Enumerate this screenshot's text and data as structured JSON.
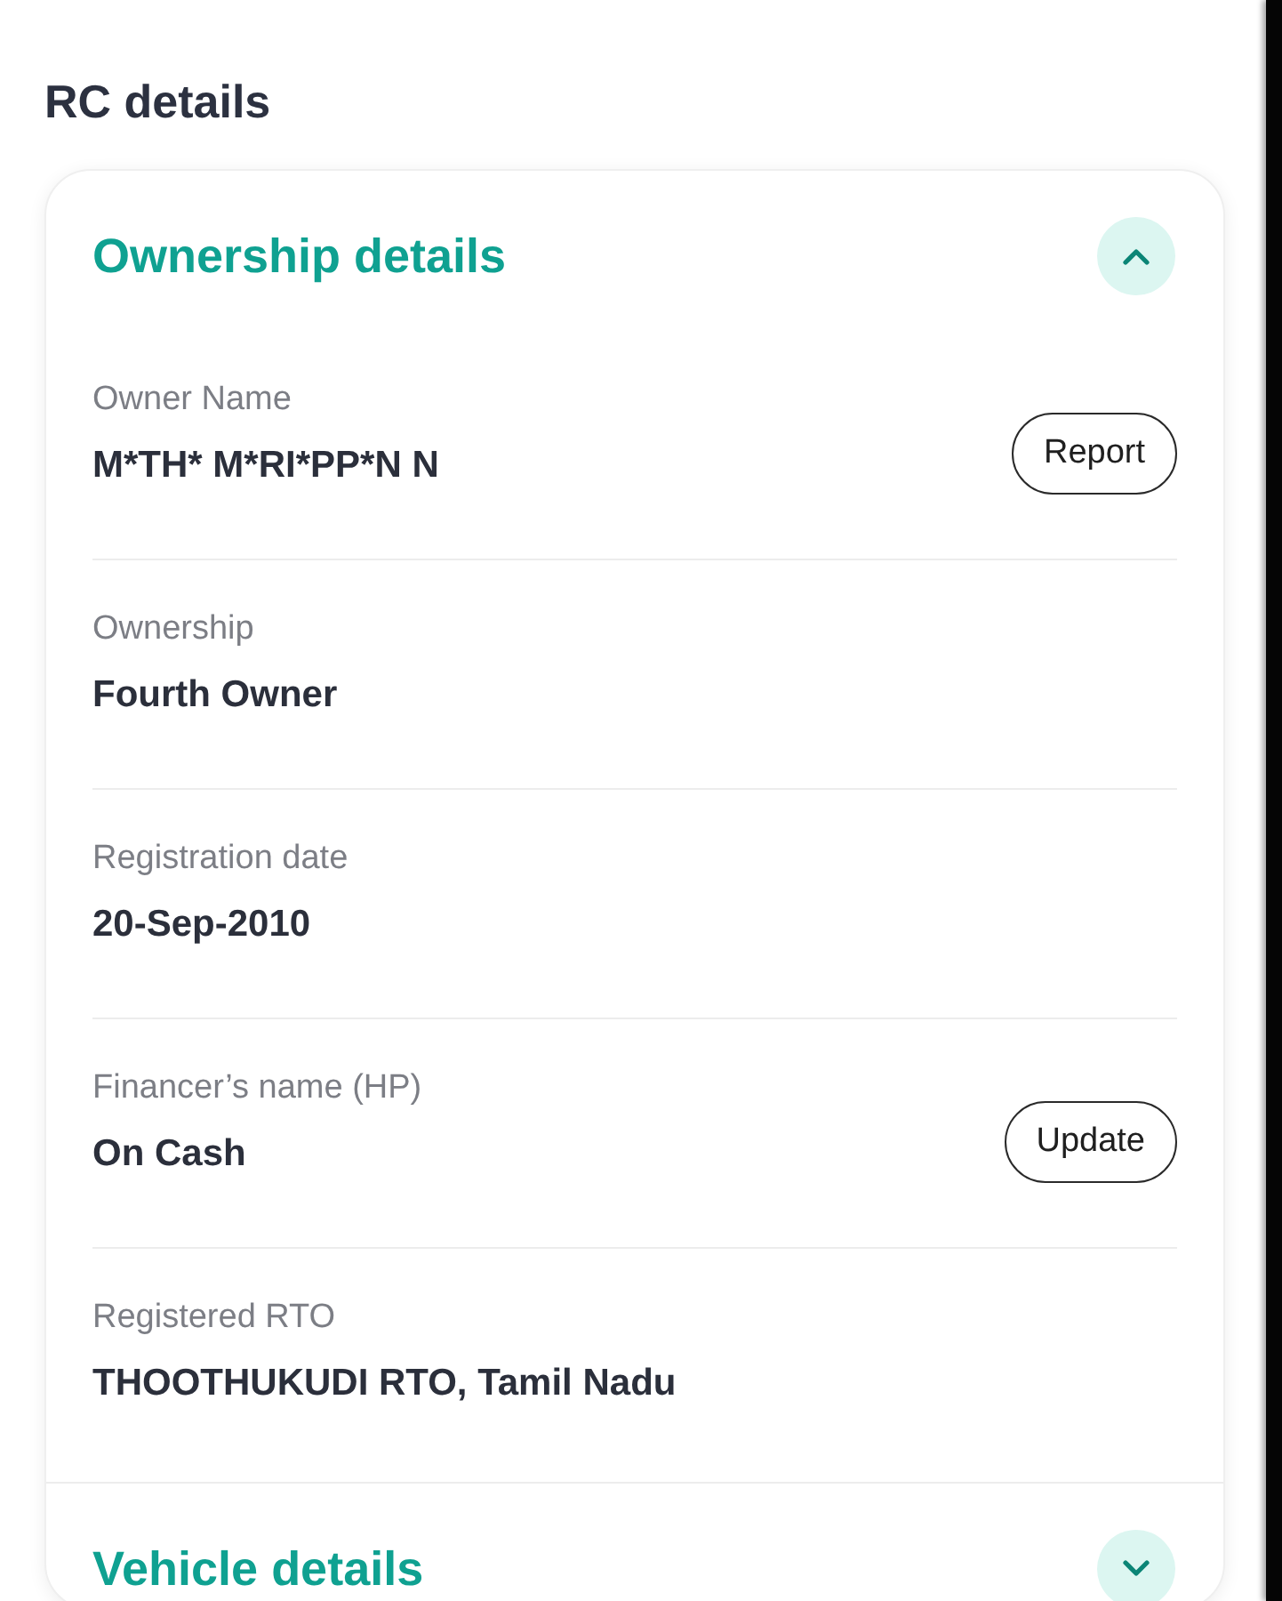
{
  "page": {
    "title": "RC details"
  },
  "sections": [
    {
      "title": "Ownership details",
      "expanded": true,
      "fields": [
        {
          "label": "Owner Name",
          "value": "M*TH* M*RI*PP*N N",
          "action": "Report"
        },
        {
          "label": "Ownership",
          "value": "Fourth Owner"
        },
        {
          "label": "Registration date",
          "value": "20-Sep-2010"
        },
        {
          "label": "Financer’s name (HP)",
          "value": "On Cash",
          "action": "Update"
        },
        {
          "label": "Registered RTO",
          "value": "THOOTHUKUDI RTO, Tamil Nadu"
        }
      ]
    },
    {
      "title": "Vehicle details",
      "expanded": false
    }
  ]
}
